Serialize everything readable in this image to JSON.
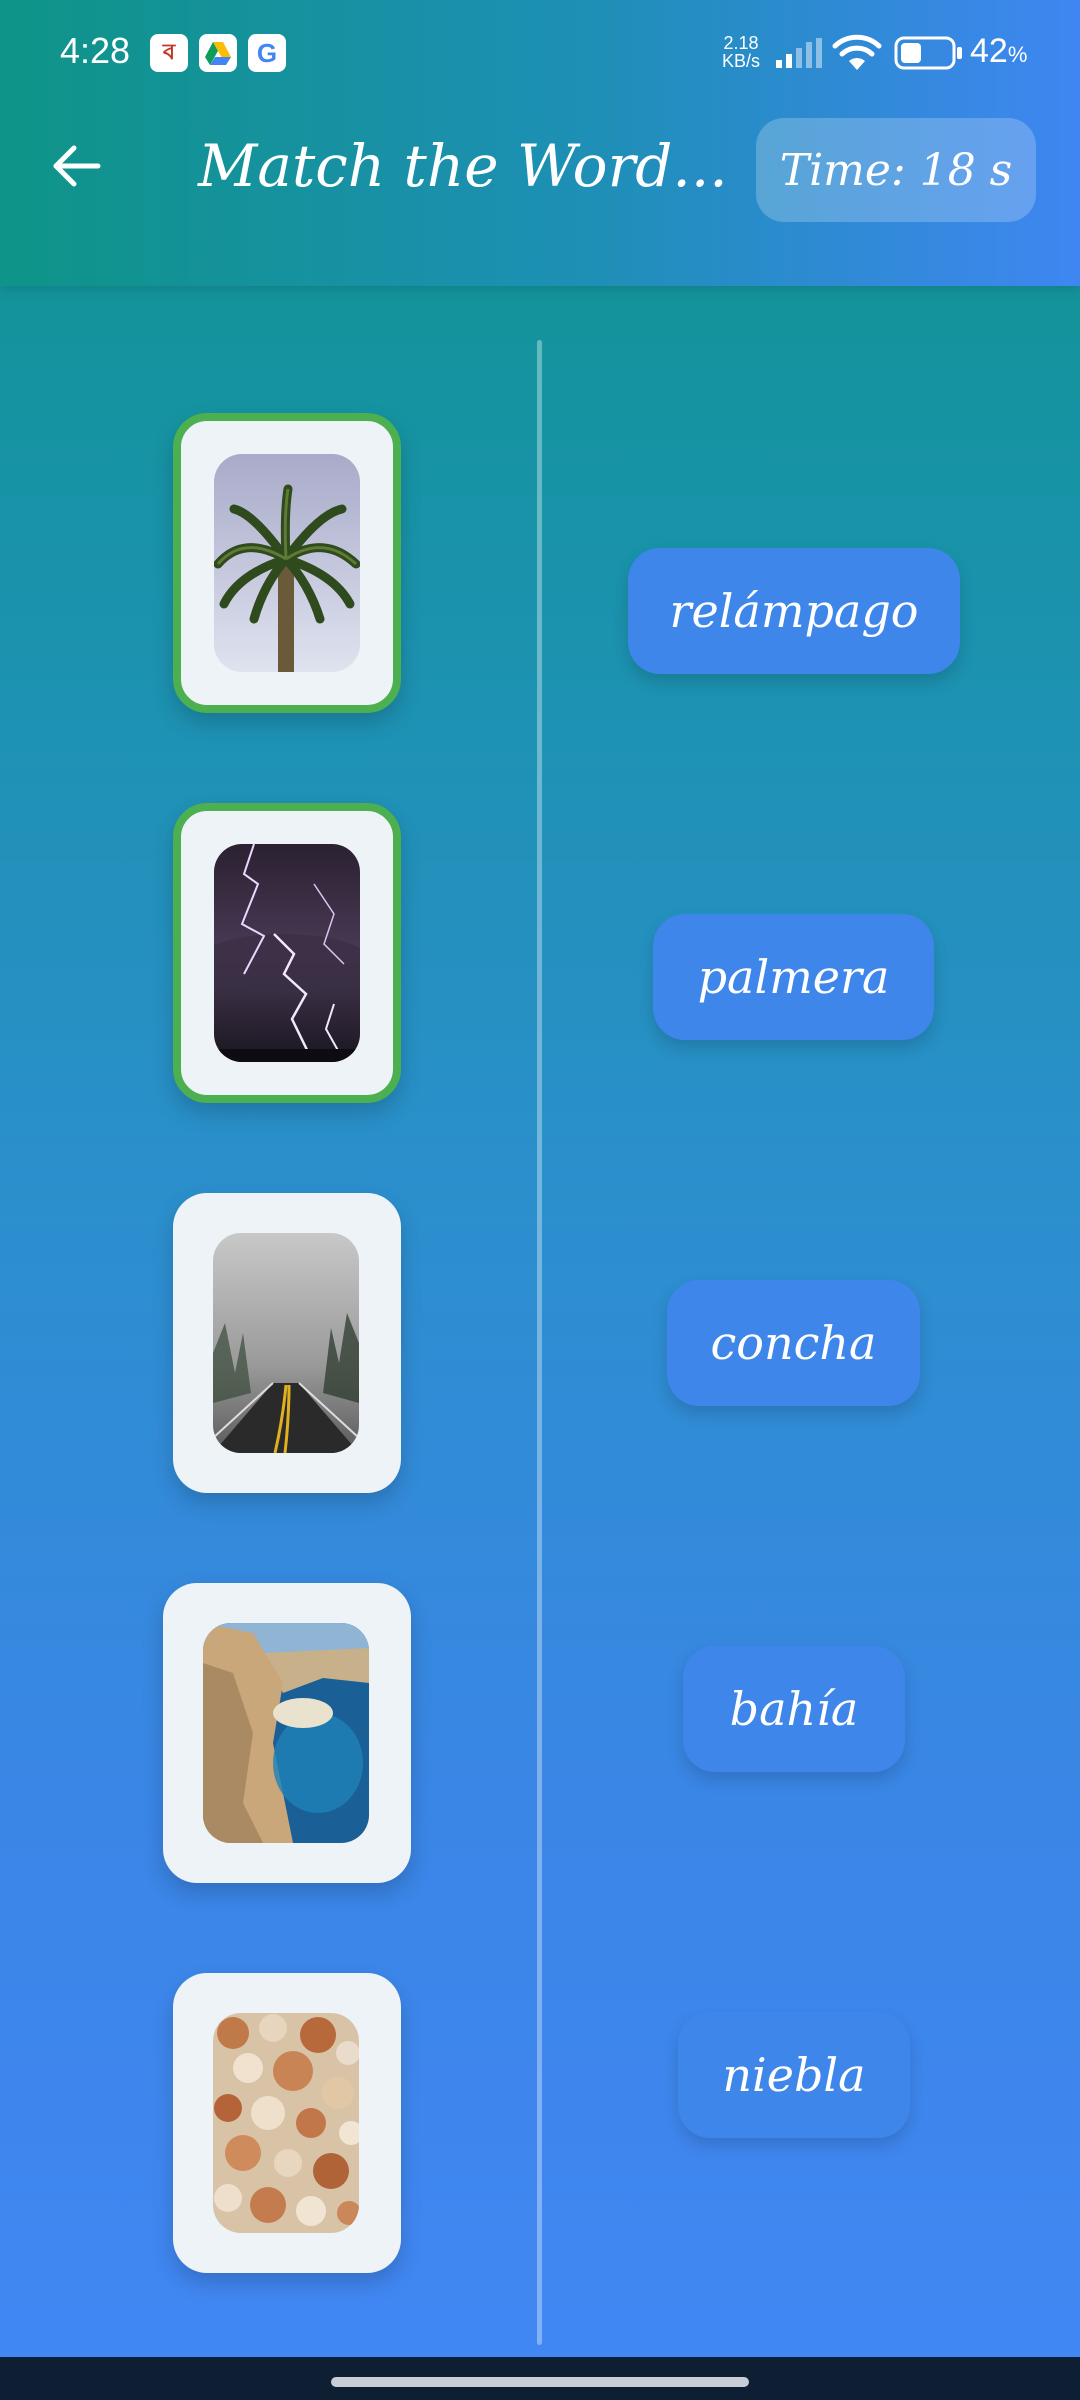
{
  "status_bar": {
    "time": "4:28",
    "notification_icons": [
      "bengali-app-icon",
      "google-drive-icon",
      "google-icon"
    ],
    "net_speed_value": "2.18",
    "net_speed_unit": "KB/s",
    "battery_percent": "42",
    "battery_unit": "%",
    "battery_level": 0.42
  },
  "header": {
    "back_icon": "arrow-left-icon",
    "title": "Match the Word...",
    "timer": "Time: 18 s"
  },
  "images": [
    {
      "id": "palm-tree",
      "icon": "palm-tree-image",
      "matched": true
    },
    {
      "id": "lightning",
      "icon": "lightning-image",
      "matched": true
    },
    {
      "id": "fog-road",
      "icon": "fog-road-image",
      "matched": false
    },
    {
      "id": "bay",
      "icon": "bay-image",
      "matched": false
    },
    {
      "id": "shells",
      "icon": "shells-image",
      "matched": false
    }
  ],
  "words": [
    {
      "label": "relámpago"
    },
    {
      "label": "palmera"
    },
    {
      "label": "concha"
    },
    {
      "label": "bahía"
    },
    {
      "label": "niebla"
    }
  ],
  "colors": {
    "matched_border": "#4caf50",
    "word_button": "#3e86ea",
    "card_bg": "#edf3f7"
  }
}
